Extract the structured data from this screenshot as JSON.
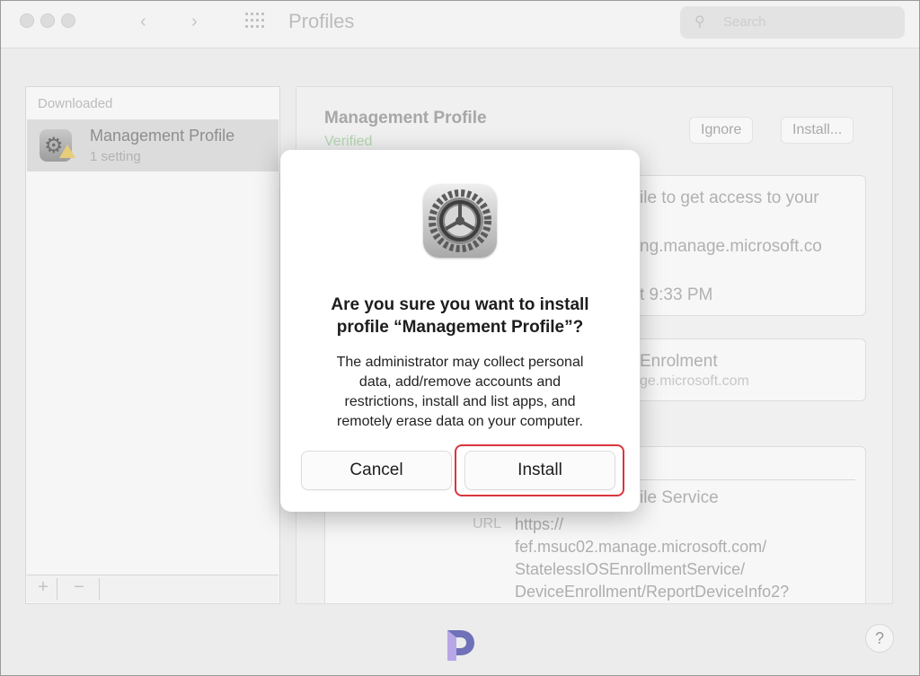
{
  "window": {
    "title": "Profiles"
  },
  "search": {
    "placeholder": "Search"
  },
  "sidebar": {
    "section_header": "Downloaded",
    "items": [
      {
        "name": "Management Profile",
        "subtitle": "1 setting"
      }
    ],
    "add_label": "+",
    "remove_label": "−"
  },
  "detail": {
    "title": "Management Profile",
    "status": "Verified",
    "ignore_label": "Ignore",
    "install_label": "Install...",
    "description_partial": "ile to get access to your",
    "domain_partial": "ng.manage.microsoft.co",
    "time_partial": "t 9:33 PM",
    "enrolment_partial": "Enrolment",
    "enrolment_host_partial": "ge.microsoft.com",
    "service_partial": "ile Service",
    "url_label": "URL",
    "url_lines": [
      "https://",
      "fef.msuc02.manage.microsoft.com/",
      "StatelessIOSEnrollmentService/",
      "DeviceEnrollment/ReportDeviceInfo2?"
    ]
  },
  "dialog": {
    "title_line1": "Are you sure you want to install",
    "title_line2": "profile “Management Profile”?",
    "body_lines": [
      "The administrator may collect personal",
      "data, add/remove accounts and",
      "restrictions, install and list apps, and",
      "remotely erase data on your computer."
    ],
    "cancel_label": "Cancel",
    "install_label": "Install"
  },
  "footer": {
    "help_label": "?"
  },
  "colors": {
    "highlight": "#d9363e",
    "verified": "#b3d6b1",
    "logo_primary": "#6f72b8",
    "logo_secondary": "#b8a7e6"
  },
  "icons": [
    "search-icon",
    "back-icon",
    "forward-icon",
    "grid-icon",
    "gear-icon",
    "warning-icon",
    "settings-app-icon",
    "logo-icon"
  ]
}
